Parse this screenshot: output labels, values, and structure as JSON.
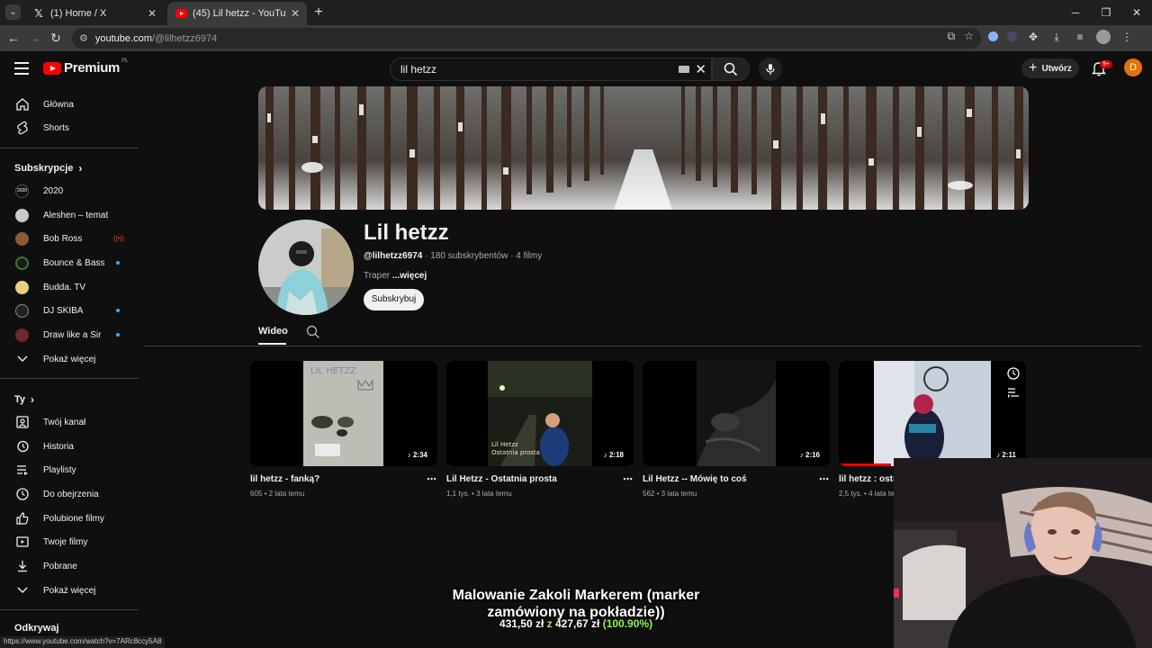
{
  "browser": {
    "tabs": [
      {
        "title": "(1) Home / X",
        "active": false
      },
      {
        "title": "(45) Lil hetzz - YouTube",
        "active": true
      }
    ],
    "url_host": "youtube.com",
    "url_path": "/@lilhetzz6974",
    "status_url": "https://www.youtube.com/watch?v=7ARc8ccy5A8"
  },
  "masthead": {
    "logo": "Premium",
    "country": "PL",
    "search_value": "lil hetzz",
    "create_label": "Utwórz",
    "notifications_badge": "9+",
    "account_initial": "D"
  },
  "sidebar": {
    "top": [
      {
        "label": "Główna",
        "icon": "home-icon"
      },
      {
        "label": "Shorts",
        "icon": "shorts-icon"
      }
    ],
    "subscriptions_heading": "Subskrypcje",
    "subscriptions": [
      {
        "label": "2020"
      },
      {
        "label": "Aleshen – temat"
      },
      {
        "label": "Bob Ross"
      },
      {
        "label": "Bounce & Bass"
      },
      {
        "label": "Budda. TV"
      },
      {
        "label": "DJ SKIBA"
      },
      {
        "label": "Draw like a Sir"
      }
    ],
    "show_more_subs": "Pokaż więcej",
    "you_heading": "Ty",
    "you_items": [
      {
        "label": "Twój kanał",
        "icon": "channel-icon"
      },
      {
        "label": "Historia",
        "icon": "history-icon"
      },
      {
        "label": "Playlisty",
        "icon": "playlist-icon"
      },
      {
        "label": "Do obejrzenia",
        "icon": "watch-later-icon"
      },
      {
        "label": "Polubione filmy",
        "icon": "thumb-up-icon"
      },
      {
        "label": "Twoje filmy",
        "icon": "your-videos-icon"
      },
      {
        "label": "Pobrane",
        "icon": "download-icon"
      },
      {
        "label": "Pokaż więcej",
        "icon": "chevron-down-icon"
      }
    ],
    "explore_heading": "Odkrywaj"
  },
  "channel": {
    "name": "Lil hetzz",
    "handle": "@lilhetzz6974",
    "subscribers": "180 subskrybentów",
    "videos_count": "4 filmy",
    "description": "Traper",
    "more": "...więcej",
    "subscribe_label": "Subskrybuj",
    "tab_label": "Wideo"
  },
  "videos": [
    {
      "title": "lil hetzz - fanką?",
      "views": "605",
      "age": "2 lata temu",
      "duration": "2:34"
    },
    {
      "title": "Lil Hetzz - Ostatnia prosta",
      "views": "1,1 tys.",
      "age": "3 lata temu",
      "duration": "2:18"
    },
    {
      "title": "Lil Hetzz -- Mówię to coś",
      "views": "562",
      "age": "3 lata temu",
      "duration": "2:16"
    },
    {
      "title": "lil hetzz : ostr",
      "views": "2,5 tys.",
      "age": "4 lata te",
      "duration": "2:11",
      "watched_fraction": 0.28
    }
  ],
  "overlay": {
    "line1": "Malowanie Zakoli Markerem (marker",
    "line2": "zamówiony na pokładzie))",
    "goal": "431,50 zł",
    "sep": "z",
    "current": "427,67 zł",
    "percent": "(100.90%)"
  }
}
